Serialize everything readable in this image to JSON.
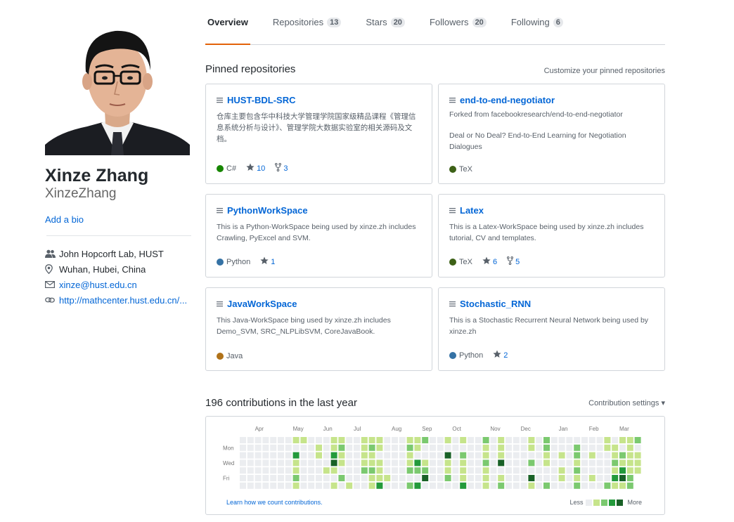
{
  "profile": {
    "full_name": "Xinze Zhang",
    "username": "XinzeZhang",
    "add_bio": "Add a bio",
    "organization": "John Hopcorft Lab, HUST",
    "location": "Wuhan, Hubei, China",
    "email": "xinze@hust.edu.cn",
    "website": "http://mathcenter.hust.edu.cn/..."
  },
  "tabs": [
    {
      "label": "Overview",
      "selected": true
    },
    {
      "label": "Repositories",
      "count": "13"
    },
    {
      "label": "Stars",
      "count": "20"
    },
    {
      "label": "Followers",
      "count": "20"
    },
    {
      "label": "Following",
      "count": "6"
    }
  ],
  "pinned": {
    "title": "Pinned repositories",
    "customize": "Customize your pinned repositories",
    "repos": [
      {
        "name": "HUST-BDL-SRC",
        "desc": "仓库主要包含华中科技大学管理学院国家级精品课程《管理信息系统分析与设计》、管理学院大数据实验室的相关源码及文档。",
        "lang": "C#",
        "lang_color": "#178600",
        "stars": "10",
        "forks": "3"
      },
      {
        "name": "end-to-end-negotiator",
        "forked_from": "Forked from facebookresearch/end-to-end-negotiator",
        "desc": "Deal or No Deal? End-to-End Learning for Negotiation Dialogues",
        "lang": "TeX",
        "lang_color": "#3D6117"
      },
      {
        "name": "PythonWorkSpace",
        "desc": "This is a Python-WorkSpace being used by xinze.zh includes Crawling, PyExcel and SVM.",
        "lang": "Python",
        "lang_color": "#3572A5",
        "stars": "1"
      },
      {
        "name": "Latex",
        "desc": "This is a Latex-WorkSpace being used by xinze.zh includes tutorial, CV and templates.",
        "lang": "TeX",
        "lang_color": "#3D6117",
        "stars": "6",
        "forks": "5"
      },
      {
        "name": "JavaWorkSpace",
        "desc": "This Java-WorkSpace bing used by xinze.zh includes Demo_SVM, SRC_NLPLibSVM, CoreJavaBook.",
        "lang": "Java",
        "lang_color": "#b07219"
      },
      {
        "name": "Stochastic_RNN",
        "desc": "This is a Stochastic Recurrent Neural Network being used by xinze.zh",
        "lang": "Python",
        "lang_color": "#3572A5",
        "stars": "2"
      }
    ]
  },
  "contributions": {
    "title": "196 contributions in the last year",
    "settings": "Contribution settings",
    "learn": "Learn how we count contributions.",
    "less": "Less",
    "more": "More",
    "months": [
      "Apr",
      "May",
      "Jun",
      "Jul",
      "Aug",
      "Sep",
      "Oct",
      "Nov",
      "Dec",
      "Jan",
      "Feb",
      "Mar"
    ],
    "day_labels": [
      "Mon",
      "Wed",
      "Fri"
    ],
    "colors": [
      "#ebedf0",
      "#c6e48b",
      "#7bc96f",
      "#239a3b",
      "#196127"
    ]
  }
}
